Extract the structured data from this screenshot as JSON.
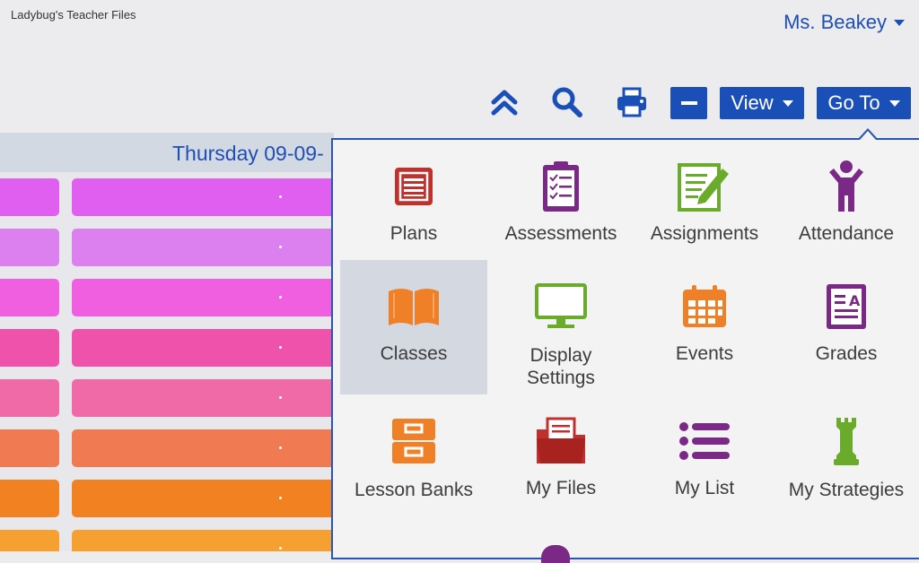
{
  "app": {
    "title": "Ladybug's Teacher Files"
  },
  "user": {
    "name": "Ms. Beakey"
  },
  "toolbar": {
    "collapse_icon": "double-chevron-up-icon",
    "search_icon": "search-icon",
    "print_icon": "printer-icon",
    "minus_icon": "minus-icon",
    "view_label": "View",
    "goto_label": "Go To"
  },
  "calendar": {
    "date_label": "Thursday 09-09-",
    "row_colors": [
      "#e05ff0",
      "#dd80ef",
      "#f05fe0",
      "#ee52aa",
      "#f06aa8",
      "#f07a52",
      "#f28122",
      "#f5a030"
    ]
  },
  "goto_menu": {
    "items": [
      {
        "label": "Plans",
        "icon": "plans-icon",
        "color": "#c0302c"
      },
      {
        "label": "Assessments",
        "icon": "clipboard-icon",
        "color": "#7a2a86"
      },
      {
        "label": "Assignments",
        "icon": "pencil-document-icon",
        "color": "#6aab2c"
      },
      {
        "label": "Attendance",
        "icon": "person-icon",
        "color": "#7a2a86"
      },
      {
        "label": "Classes",
        "icon": "open-book-icon",
        "color": "#f08028"
      },
      {
        "label": "Display Settings",
        "icon": "monitor-icon",
        "color": "#6aab2c"
      },
      {
        "label": "Events",
        "icon": "calendar-icon",
        "color": "#f08028"
      },
      {
        "label": "Grades",
        "icon": "grade-document-icon",
        "color": "#7a2a86"
      },
      {
        "label": "Lesson Banks",
        "icon": "file-cabinet-icon",
        "color": "#f08028"
      },
      {
        "label": "My Files",
        "icon": "folder-icon",
        "color": "#c0302c"
      },
      {
        "label": "My List",
        "icon": "list-icon",
        "color": "#7a2a86"
      },
      {
        "label": "My Strategies",
        "icon": "chess-rook-icon",
        "color": "#6aab2c"
      }
    ]
  }
}
